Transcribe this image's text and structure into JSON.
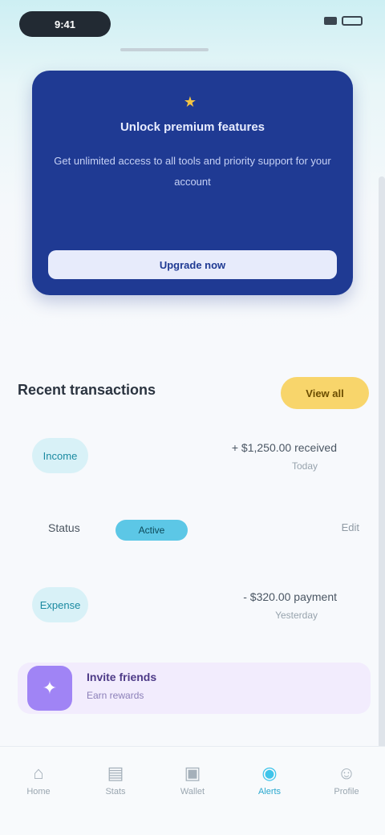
{
  "status_bar": {
    "time": "9:41"
  },
  "promo": {
    "icon": "star-icon",
    "title": "Unlock premium features",
    "description": "Get unlimited access to all tools and priority support for your account",
    "button_label": "Upgrade now"
  },
  "section": {
    "title": "Recent transactions",
    "badge": "View all"
  },
  "list": [
    {
      "tag": "Income",
      "text": "+ $1,250.00 received",
      "sub": "Today"
    },
    {
      "tag": "Expense",
      "text": "- $320.00 payment",
      "sub": "Yesterday"
    }
  ],
  "row_with_chip": {
    "label": "Status",
    "chip": "Active",
    "right": "Edit"
  },
  "purple_card": {
    "icon": "gift-icon",
    "title": "Invite friends",
    "subtitle": "Earn rewards"
  },
  "nav": [
    {
      "icon": "home-icon",
      "glyph": "⌂",
      "label": "Home"
    },
    {
      "icon": "chart-icon",
      "glyph": "▤",
      "label": "Stats"
    },
    {
      "icon": "wallet-icon",
      "glyph": "▣",
      "label": "Wallet"
    },
    {
      "icon": "bell-icon",
      "glyph": "◉",
      "label": "Alerts",
      "active": true
    },
    {
      "icon": "user-icon",
      "glyph": "☺",
      "label": "Profile"
    }
  ],
  "colors": {
    "promo_bg": "#1f3a93",
    "badge_bg": "#f8d56b",
    "chip_bg": "#5cc7e6",
    "purple_bg": "#f2ecfd",
    "purple_icon": "#a084f5",
    "nav_active": "#3fc4ea"
  }
}
